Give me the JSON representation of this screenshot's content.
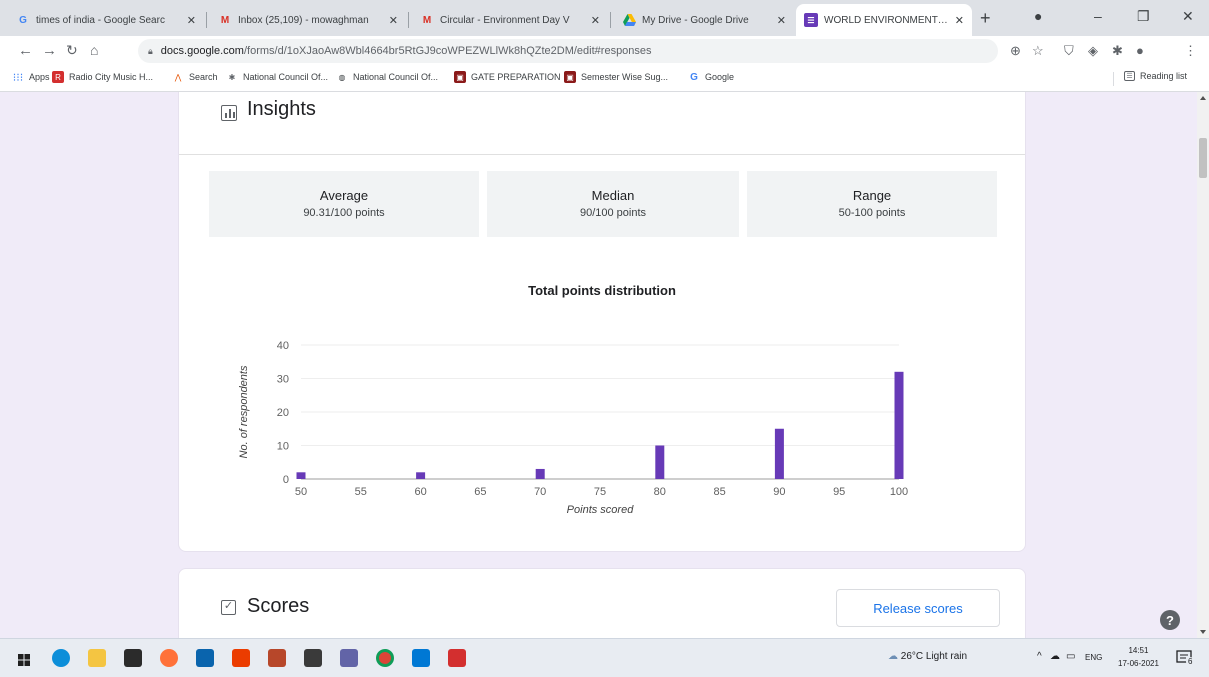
{
  "browser": {
    "tabs": [
      {
        "title": "times of india - Google Searc",
        "favicon": "google-icon",
        "color": "#4285f4"
      },
      {
        "title": "Inbox (25,109) - mowaghman",
        "favicon": "gmail-icon",
        "color": "#d93025"
      },
      {
        "title": "Circular - Environment Day V",
        "favicon": "gmail-icon",
        "color": "#d93025"
      },
      {
        "title": "My Drive - Google Drive",
        "favicon": "drive-icon",
        "color": "#0f9d58"
      },
      {
        "title": "WORLD ENVIRONMENT DAY",
        "favicon": "forms-icon",
        "color": "#673ab7"
      }
    ],
    "active_tab": 4,
    "address": {
      "domain": "docs.google.com",
      "path": "/forms/d/1oXJaoAw8Wbl4664br5RtGJ9coWPEZWLlWk8hQZte2DM/edit#responses"
    },
    "bookmarks": [
      {
        "label": "Apps",
        "icon": "apps-grid-icon",
        "color": "#4285f4"
      },
      {
        "label": "Radio City Music H...",
        "icon": "radio-city-icon",
        "color": "#d32f2f"
      },
      {
        "label": "Search",
        "icon": "search-bookmark-icon",
        "color": "#e65100"
      },
      {
        "label": "National Council Of...",
        "icon": "council-icon",
        "color": "#5f6368"
      },
      {
        "label": "National Council Of...",
        "icon": "globe-icon",
        "color": "#3c4043"
      },
      {
        "label": "GATE PREPARATION",
        "icon": "gate-icon",
        "color": "#8b1a1a"
      },
      {
        "label": "Semester Wise Sug...",
        "icon": "semester-icon",
        "color": "#8b1a1a"
      },
      {
        "label": "Google",
        "icon": "google-icon",
        "color": "#4285f4"
      }
    ],
    "reading_list": "Reading list"
  },
  "insights": {
    "title": "Insights",
    "stats": [
      {
        "label": "Average",
        "value": "90.31/100 points"
      },
      {
        "label": "Median",
        "value": "90/100 points"
      },
      {
        "label": "Range",
        "value": "50-100 points"
      }
    ]
  },
  "chart_data": {
    "type": "bar",
    "title": "Total points distribution",
    "xlabel": "Points scored",
    "ylabel": "No. of respondents",
    "x_ticks": [
      50,
      55,
      60,
      65,
      70,
      75,
      80,
      85,
      90,
      95,
      100
    ],
    "y_ticks": [
      0,
      10,
      20,
      30,
      40
    ],
    "ylim": [
      0,
      40
    ],
    "xlim": [
      50,
      100
    ],
    "x": [
      50,
      60,
      70,
      80,
      90,
      100
    ],
    "values": [
      2,
      2,
      3,
      10,
      15,
      32
    ],
    "bar_color": "#673ab7",
    "grid": true
  },
  "scores": {
    "title": "Scores",
    "release_label": "Release scores"
  },
  "taskbar": {
    "weather": "26°C  Light rain",
    "language": "ENG",
    "time": "14:51",
    "date": "17-06-2021",
    "notification_count": "6"
  }
}
